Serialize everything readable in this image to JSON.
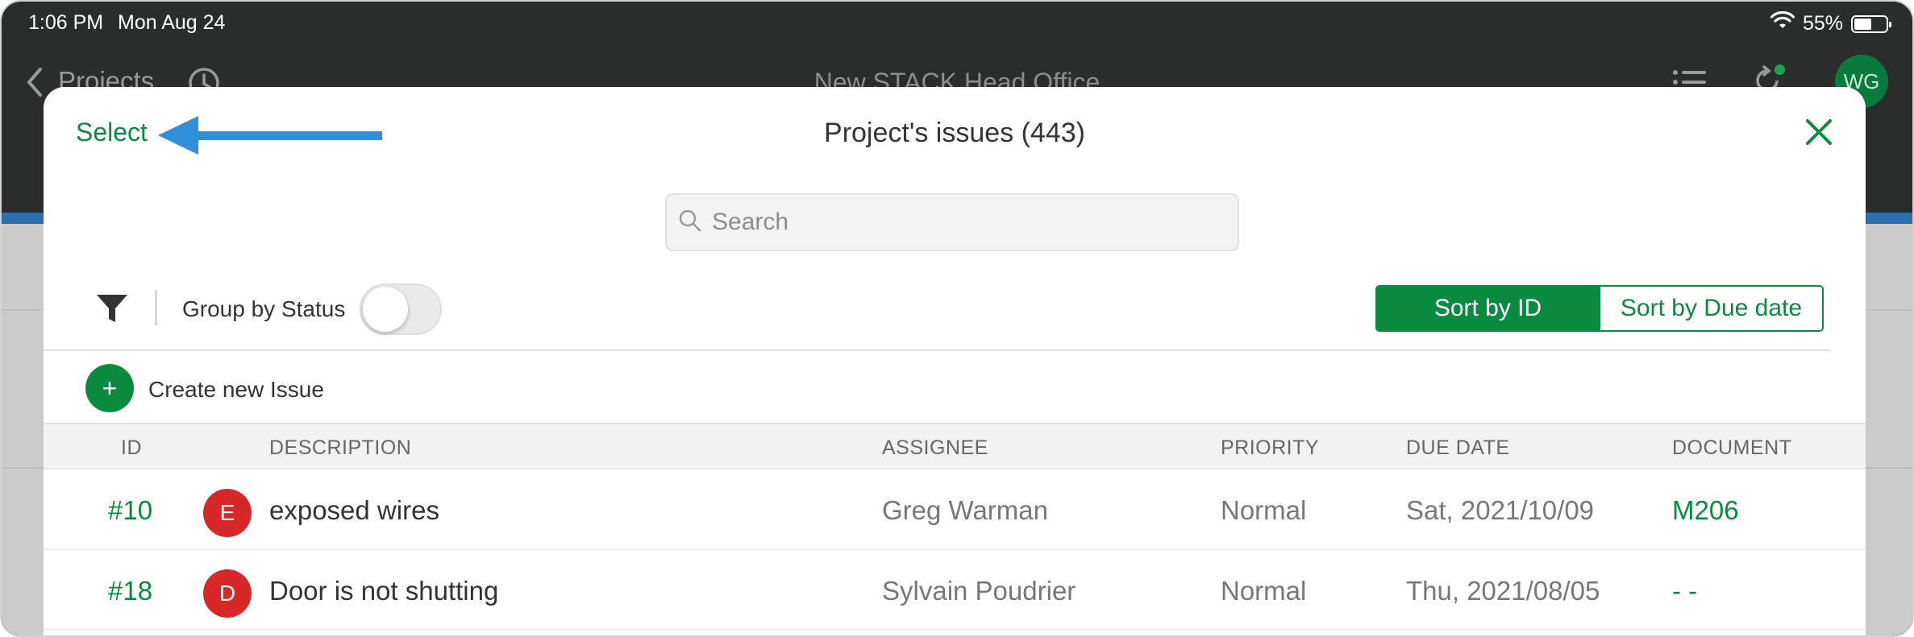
{
  "status_bar": {
    "time": "1:06 PM",
    "date": "Mon Aug 24",
    "battery": "55%",
    "battery_level": 0.55
  },
  "app_nav": {
    "back_label": "Projects",
    "title": "New STACK Head Office",
    "avatar_initials": "WG"
  },
  "modal": {
    "select_label": "Select",
    "title": "Project's issues (443)",
    "search_placeholder": "Search",
    "group_by_label": "Group by Status",
    "group_by_enabled": false,
    "sort_by_id_label": "Sort by ID",
    "sort_by_due_label": "Sort by Due date",
    "active_sort": "Sort by ID",
    "create_label": "Create new Issue",
    "create_icon": "+"
  },
  "table": {
    "headers": {
      "id": "ID",
      "description": "DESCRIPTION",
      "assignee": "ASSIGNEE",
      "priority": "PRIORITY",
      "due_date": "DUE DATE",
      "document": "DOCUMENT"
    },
    "rows": [
      {
        "id": "#10",
        "badge": "E",
        "description": "exposed wires",
        "assignee": "Greg Warman",
        "priority": "Normal",
        "due_date": "Sat, 2021/10/09",
        "document": "M206"
      },
      {
        "id": "#18",
        "badge": "D",
        "description": "Door is not shutting",
        "assignee": "Sylvain Poudrier",
        "priority": "Normal",
        "due_date": "Thu, 2021/08/05",
        "document": "- -"
      }
    ]
  },
  "colors": {
    "accent_green": "#0a8a3f",
    "badge_red": "#d62828",
    "annotation_arrow": "#2f8fd8"
  }
}
